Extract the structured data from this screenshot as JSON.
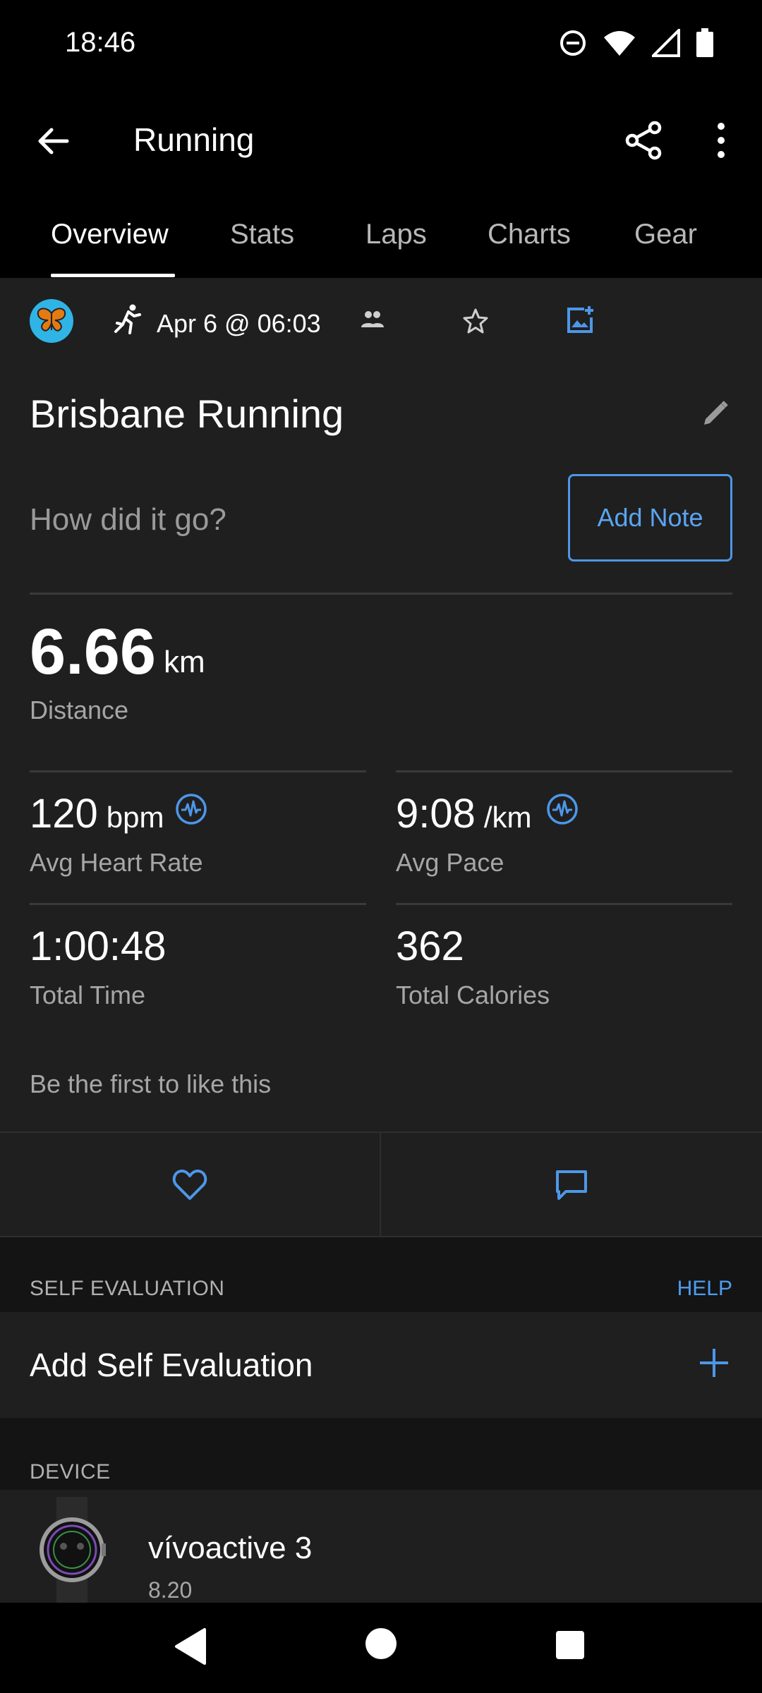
{
  "status_bar": {
    "time": "18:46"
  },
  "app_bar": {
    "title": "Running"
  },
  "tabs": [
    {
      "label": "Overview"
    },
    {
      "label": "Stats"
    },
    {
      "label": "Laps"
    },
    {
      "label": "Charts"
    },
    {
      "label": "Gear"
    }
  ],
  "meta": {
    "date": "Apr 6 @ 06:03"
  },
  "activity": {
    "title": "Brisbane Running",
    "note_prompt": "How did it go?",
    "add_note_label": "Add Note"
  },
  "distance": {
    "value": "6.66",
    "unit": "km",
    "label": "Distance"
  },
  "stats": {
    "heart_rate": {
      "value": "120",
      "unit": "bpm",
      "label": "Avg Heart Rate"
    },
    "pace": {
      "value": "9:08",
      "unit": "/km",
      "label": "Avg Pace"
    },
    "time": {
      "value": "1:00:48",
      "label": "Total Time"
    },
    "calories": {
      "value": "362",
      "label": "Total Calories"
    }
  },
  "likes_text": "Be the first to like this",
  "self_evaluation": {
    "header": "SELF EVALUATION",
    "help": "HELP",
    "row_label": "Add Self Evaluation"
  },
  "device": {
    "header": "DEVICE",
    "name": "vívoactive 3",
    "version": "8.20"
  },
  "colors": {
    "accent": "#4d97e8",
    "panel": "#1f1f1f",
    "background": "#000000"
  }
}
